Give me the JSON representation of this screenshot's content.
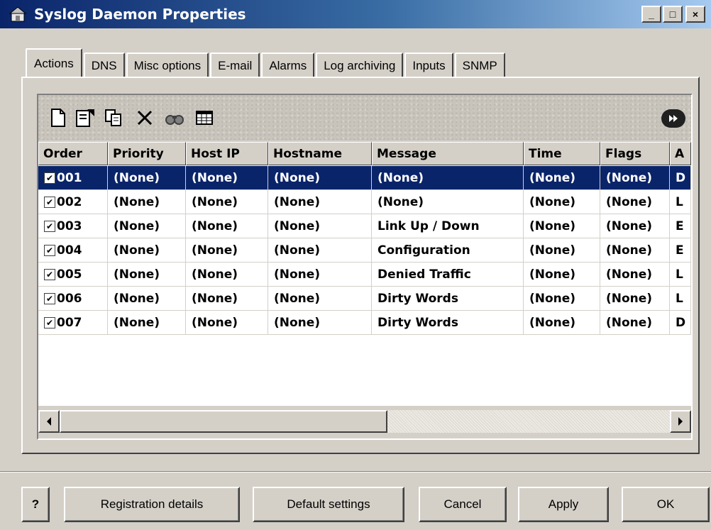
{
  "window": {
    "title": "Syslog Daemon Properties",
    "minimize_glyph": "_",
    "maximize_glyph": "□",
    "close_glyph": "×"
  },
  "tabs": [
    {
      "label": "Actions",
      "active": true
    },
    {
      "label": "DNS",
      "active": false
    },
    {
      "label": "Misc options",
      "active": false
    },
    {
      "label": "E-mail",
      "active": false
    },
    {
      "label": "Alarms",
      "active": false
    },
    {
      "label": "Log archiving",
      "active": false
    },
    {
      "label": "Inputs",
      "active": false
    },
    {
      "label": "SNMP",
      "active": false
    }
  ],
  "toolbar": {
    "icons": [
      "new-document-icon",
      "properties-icon",
      "copy-icon",
      "delete-icon",
      "find-icon",
      "columns-icon",
      "forward-icon"
    ]
  },
  "grid": {
    "columns": [
      "Order",
      "Priority",
      "Host IP",
      "Hostname",
      "Message",
      "Time",
      "Flags",
      "A"
    ],
    "rows": [
      {
        "checked": true,
        "order": "001",
        "priority": "(None)",
        "host_ip": "(None)",
        "hostname": "(None)",
        "message": "(None)",
        "time": "(None)",
        "flags": "(None)",
        "action": "D",
        "selected": true
      },
      {
        "checked": true,
        "order": "002",
        "priority": "(None)",
        "host_ip": "(None)",
        "hostname": "(None)",
        "message": "(None)",
        "time": "(None)",
        "flags": "(None)",
        "action": "L",
        "selected": false
      },
      {
        "checked": true,
        "order": "003",
        "priority": "(None)",
        "host_ip": "(None)",
        "hostname": "(None)",
        "message": "Link Up / Down",
        "time": "(None)",
        "flags": "(None)",
        "action": "E",
        "selected": false
      },
      {
        "checked": true,
        "order": "004",
        "priority": "(None)",
        "host_ip": "(None)",
        "hostname": "(None)",
        "message": "Configuration",
        "time": "(None)",
        "flags": "(None)",
        "action": "E",
        "selected": false
      },
      {
        "checked": true,
        "order": "005",
        "priority": "(None)",
        "host_ip": "(None)",
        "hostname": "(None)",
        "message": "Denied Traffic",
        "time": "(None)",
        "flags": "(None)",
        "action": "L",
        "selected": false
      },
      {
        "checked": true,
        "order": "006",
        "priority": "(None)",
        "host_ip": "(None)",
        "hostname": "(None)",
        "message": "Dirty Words",
        "time": "(None)",
        "flags": "(None)",
        "action": "L",
        "selected": false
      },
      {
        "checked": true,
        "order": "007",
        "priority": "(None)",
        "host_ip": "(None)",
        "hostname": "(None)",
        "message": "Dirty Words",
        "time": "(None)",
        "flags": "(None)",
        "action": "D",
        "selected": false
      }
    ]
  },
  "buttons": {
    "help": "?",
    "registration": "Registration details",
    "default_settings": "Default settings",
    "cancel": "Cancel",
    "apply": "Apply",
    "ok": "OK"
  },
  "colors": {
    "selection": "#0a246a",
    "face": "#d4d0c8"
  }
}
